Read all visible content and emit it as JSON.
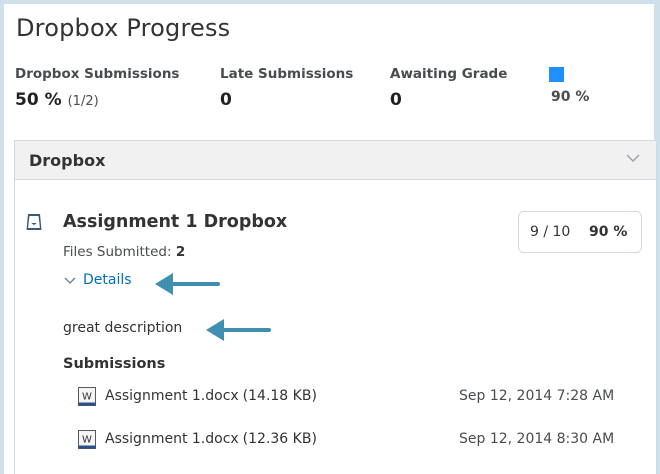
{
  "page": {
    "title": "Dropbox Progress"
  },
  "stats": [
    {
      "label": "Dropbox Submissions",
      "value": "50 %",
      "sub": "(1/2)"
    },
    {
      "label": "Late Submissions",
      "value": "0"
    },
    {
      "label": "Awaiting Grade",
      "value": "0"
    }
  ],
  "progress": {
    "value_text": "90 %",
    "color": "#1e90ff"
  },
  "panel": {
    "title": "Dropbox",
    "chevron_icon": "chevron-down-icon"
  },
  "assignment": {
    "icon": "dropbox-icon",
    "title": "Assignment 1 Dropbox",
    "files_submitted_label": "Files Submitted:",
    "files_submitted_count": "2",
    "score_fraction": "9 / 10",
    "score_percent": "90 %",
    "details_label": "Details",
    "description": "great description",
    "submissions_heading": "Submissions",
    "submissions": [
      {
        "file": "Assignment 1.docx",
        "size": "(14.18 KB)",
        "date": "Sep 12, 2014 7:28 AM",
        "icon": "word-document-icon"
      },
      {
        "file": "Assignment 1.docx",
        "size": "(12.36 KB)",
        "date": "Sep 12, 2014 8:30 AM",
        "icon": "word-document-icon"
      }
    ]
  },
  "colors": {
    "accent_link": "#006fbf",
    "annotation_arrow": "#3f8fb0",
    "frame": "#cfe0ea"
  }
}
